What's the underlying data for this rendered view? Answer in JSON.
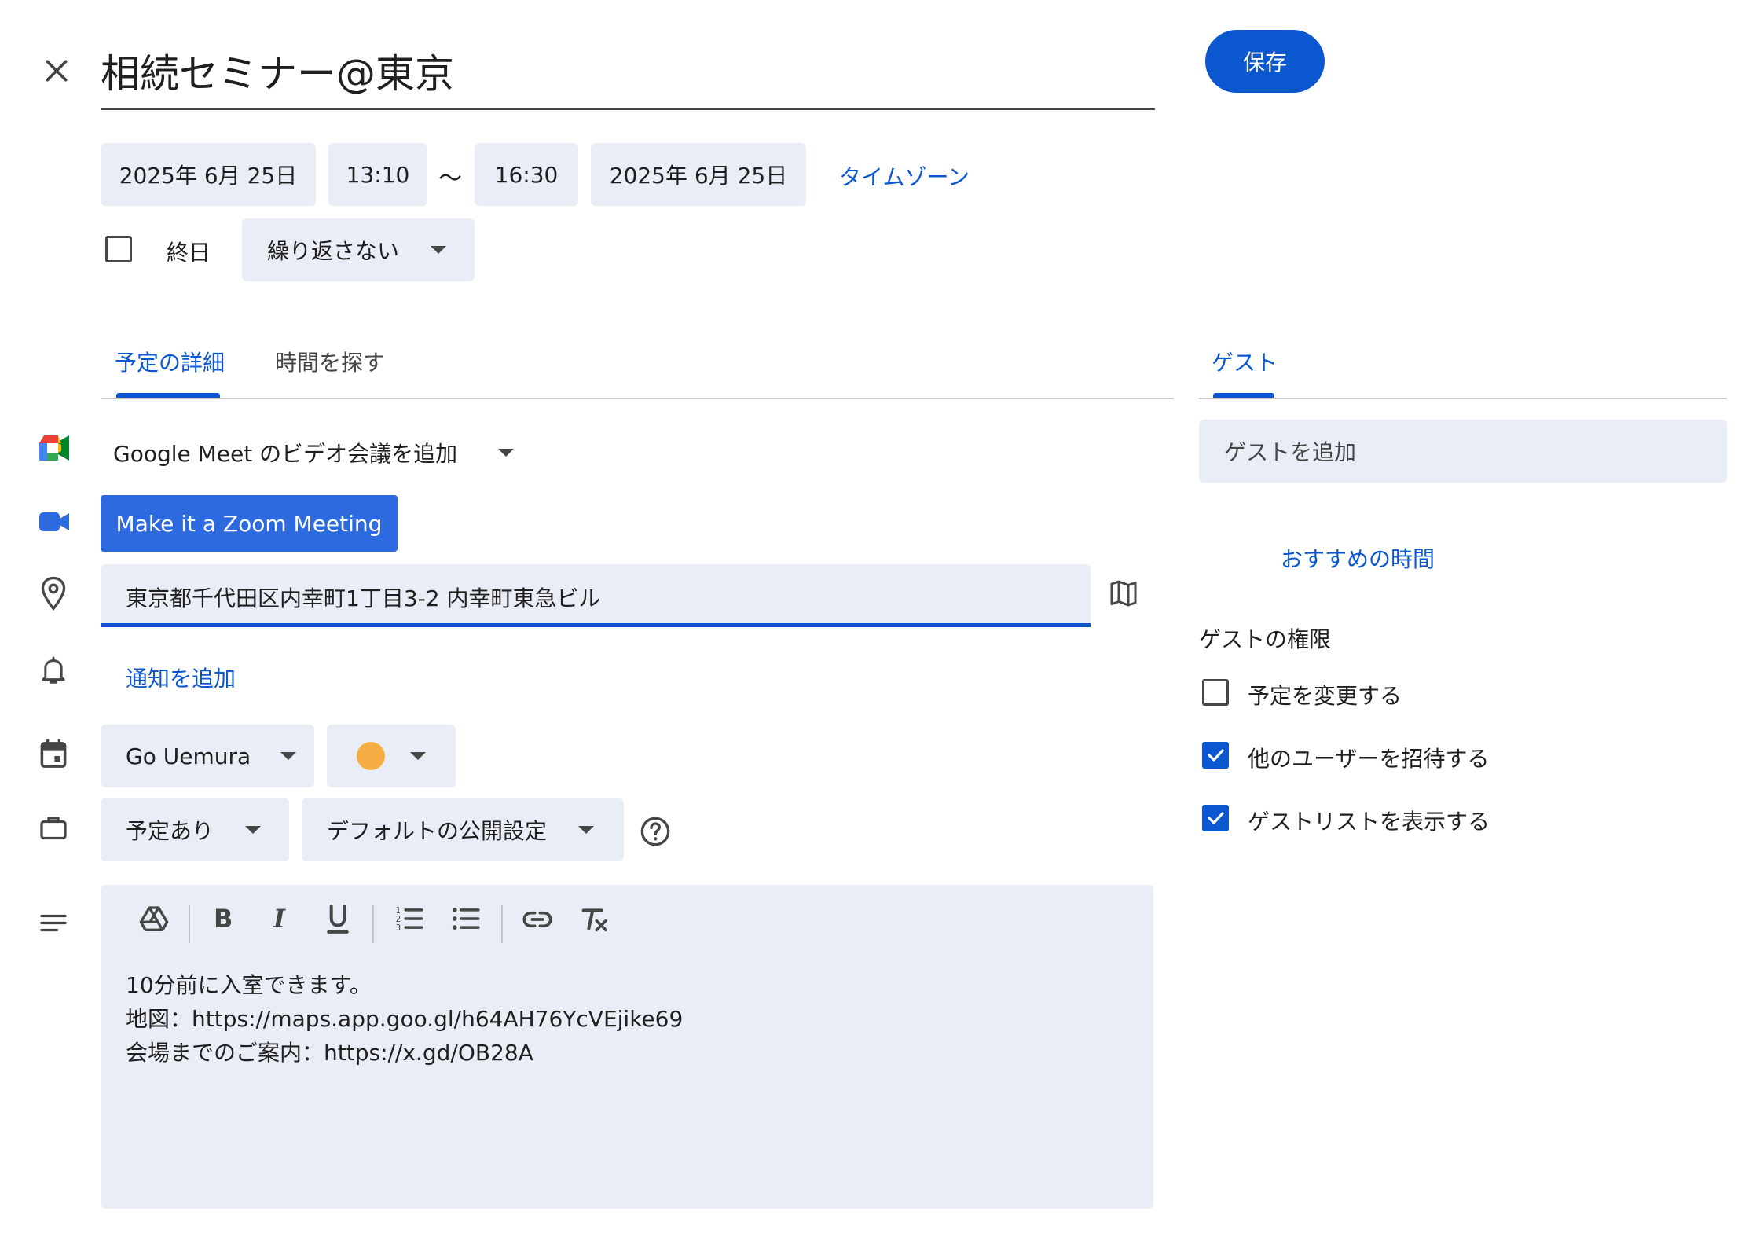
{
  "header": {
    "title": "相続セミナー@東京",
    "save_label": "保存"
  },
  "datetime": {
    "start_date": "2025年 6月 25日",
    "start_time": "13:10",
    "separator": "〜",
    "end_time": "16:30",
    "end_date": "2025年 6月 25日",
    "timezone_label": "タイムゾーン",
    "all_day_label": "終日",
    "repeat_label": "繰り返さない"
  },
  "tabs": {
    "details": "予定の詳細",
    "find_time": "時間を探す",
    "guests": "ゲスト"
  },
  "details": {
    "meet_label": "Google Meet のビデオ会議を追加",
    "zoom_label": "Make it a Zoom Meeting",
    "location_value": "東京都千代田区内幸町1丁目3-2 内幸町東急ビル",
    "add_notification": "通知を追加",
    "calendar_owner": "Go Uemura",
    "event_color": "#f6ae44",
    "availability": "予定あり",
    "visibility": "デフォルトの公開設定",
    "description_lines": [
      "10分前に入室できます。",
      "地図：https://maps.app.goo.gl/h64AH76YcVEjike69",
      "会場までのご案内：https://x.gd/OB28A"
    ]
  },
  "guests": {
    "add_placeholder": "ゲストを追加",
    "suggested_times": "おすすめの時間",
    "permissions_heading": "ゲストの権限",
    "permissions": [
      {
        "label": "予定を変更する",
        "checked": false
      },
      {
        "label": "他のユーザーを招待する",
        "checked": true
      },
      {
        "label": "ゲストリストを表示する",
        "checked": true
      }
    ]
  },
  "colors": {
    "accent": "#0b57d0",
    "chip_bg": "#e9eef6",
    "zoom_blue": "#2d6ae0"
  }
}
